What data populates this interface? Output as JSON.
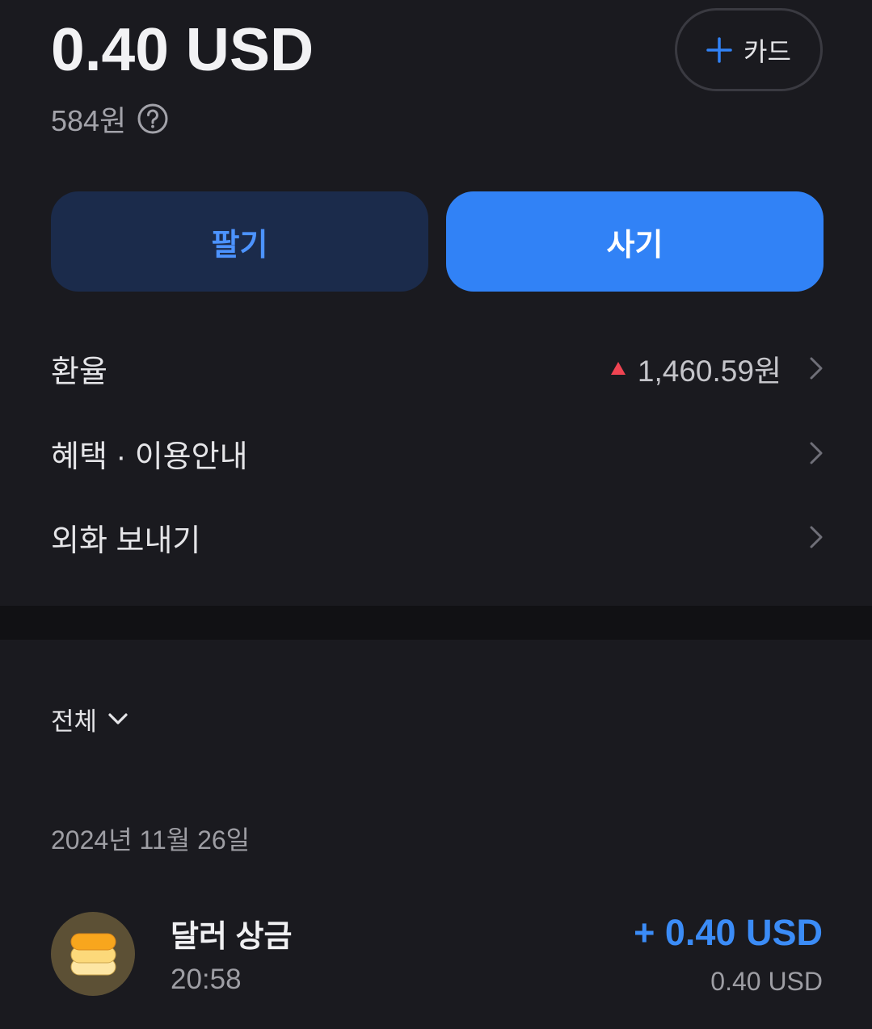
{
  "balance": {
    "amount": "0.40 USD",
    "krw": "584원",
    "help_icon": "question-circle-icon"
  },
  "card_button": {
    "icon": "plus-icon",
    "label": "카드"
  },
  "actions": {
    "sell_label": "팔기",
    "buy_label": "사기"
  },
  "menu": [
    {
      "label": "환율",
      "value": "1,460.59원",
      "trend_icon": "triangle-up-icon",
      "chevron_icon": "chevron-right-icon"
    },
    {
      "label": "혜택 · 이용안내",
      "chevron_icon": "chevron-right-icon"
    },
    {
      "label": "외화 보내기",
      "chevron_icon": "chevron-right-icon"
    }
  ],
  "filter": {
    "label": "전체",
    "icon": "chevron-down-icon"
  },
  "history": {
    "date": "2024년 11월 26일",
    "items": [
      {
        "icon": "coin-stack-icon",
        "title": "달러 상금",
        "time": "20:58",
        "amount": "+ 0.40 USD",
        "balance_after": "0.40 USD"
      }
    ]
  },
  "colors": {
    "background": "#1a1a1f",
    "section_divider": "#111114",
    "accent": "#3182f6",
    "sell_button_bg": "#1b2b4b",
    "sell_button_text": "#4c93ff",
    "rate_up": "#f04452",
    "positive_amount": "#3b8cf7"
  }
}
